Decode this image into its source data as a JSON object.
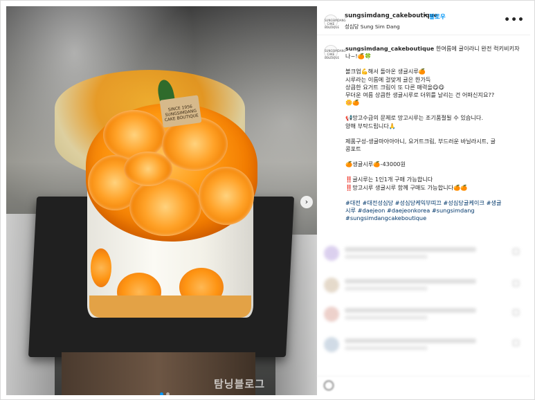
{
  "post": {
    "username": "sungsimdang_cakeboutique",
    "separator": "•",
    "follow_label": "팔로우",
    "location": "성심당 Sung Sim Dang",
    "more_label": "•••",
    "avatar_text": "SUNGSIMDANG CAKE BOUTIQUE"
  },
  "image": {
    "tag_text": "SINCE 1956 SUNGSIMDANG CAKE BOUTIQUE",
    "next_label": "›",
    "watermark": "탐닝블로그"
  },
  "caption": {
    "username": "sungsimdang_cakeboutique",
    "lines": [
      "한여름에 귤이라니 완전 럭키비키자",
      "나~!🍊🍀",
      "",
      "볼크업💪해서 돌아온 생귤시루🍊",
      "시루라는 이름에 걸맞게 귤은 한가득",
      "상큼한 요거트 크림이 또 다른 매력을😋😋",
      "무더운 여름 상큼한 생귤시루로 더위를 날리는 건 어떠신지요??",
      "🌼🍊",
      "",
      "📢망고수급의 문제로 망고시루는 조기품절될 수 있습니다.",
      "양해 부탁드립니다🙏",
      "",
      "제품구성-생귤마아아아니, 요거트크림, 부드러운 바닐라시트, 귤",
      "콩포트",
      "",
      "🍊생귤시루🍊-43000원",
      "",
      "‼️귤시루는 1인1개 구매 가능합니다",
      "‼️망고시루 생귤시루 함께 구매도 가능합니다🍊🍊"
    ],
    "hashtags": [
      "#대전 #대전성심당 #성심당케익부띠끄 #성심당귤케이크 #생귤",
      "시루 #daejeon #daejeonkorea #sungsimdang",
      "#sungsimdangcakeboutique"
    ]
  },
  "colors": {
    "link_blue": "#0095f6",
    "hashtag": "#00376b",
    "text": "#262626"
  }
}
